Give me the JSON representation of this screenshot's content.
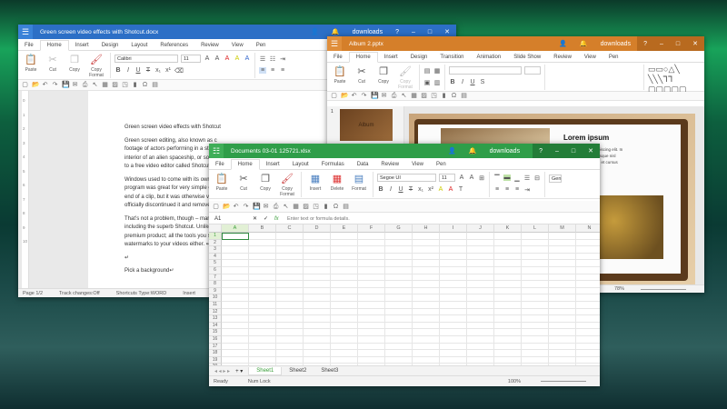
{
  "word": {
    "title": "Green screen video effects with Shotcut.docx",
    "user": "downloads",
    "tabs": [
      "File",
      "Home",
      "Insert",
      "Design",
      "Layout",
      "References",
      "Review",
      "View",
      "Pen"
    ],
    "active_tab": "Home",
    "clipboard": [
      "Paste",
      "Cut",
      "Copy",
      "Copy Format"
    ],
    "font": "Calibri",
    "size": "11",
    "quick_icons": [
      "new-icon",
      "open-icon",
      "undo-icon",
      "redo-icon",
      "save-icon",
      "mail-icon",
      "print-icon",
      "pointer-icon",
      "table-icon",
      "image-icon",
      "shape-icon",
      "chart-icon",
      "omega-icon",
      "note-icon"
    ],
    "paragraphs": [
      "Green screen video effects with Shotcut",
      "Green screen editing, also known as c|footage of actors performing in a stu|interior of an alien spaceship, or som|to a free video editor called Shotcut, ",
      "Windows used to come with its own v|program was great for very simple ed|end of a clip, but it was otherwise ver|officially discontinued it and removed",
      "That’s not a problem, though – many|including the superb Shotcut. Unlike c|premium product; all the tools you se|watermarks to your videos either. ↵",
      "↵",
      "Pick a background↵"
    ],
    "ruler": [
      "0",
      "1",
      "2",
      "3",
      "4",
      "5",
      "6",
      "7",
      "8",
      "9",
      "10"
    ],
    "status": [
      "Page 1/2",
      "Track changes:Off",
      "Shortcuts Type:WORD",
      "Insert"
    ]
  },
  "ppt": {
    "title": "Album 2.pptx",
    "user": "downloads",
    "tabs": [
      "File",
      "Home",
      "Insert",
      "Design",
      "Transition",
      "Animation",
      "Slide Show",
      "Review",
      "View",
      "Pen"
    ],
    "active_tab": "Home",
    "clipboard": [
      "Paste",
      "Cut",
      "Copy",
      "Copy Format"
    ],
    "thumbs": [
      {
        "num": "1",
        "label": "Album"
      },
      {
        "num": "2",
        "label": ""
      }
    ],
    "slide": {
      "heading": "Lorem ipsum",
      "body": [
        "...t, consectetur adipiscing elit. In",
        "...pulvinar, at scelerisque nisl",
        "...t malesuada nulla, et cursus"
      ]
    },
    "zoom": "78%"
  },
  "excel": {
    "title": "Documents 03-01 125721.xlsx",
    "user": "downloads",
    "tabs": [
      "File",
      "Home",
      "Insert",
      "Layout",
      "Formulas",
      "Data",
      "Review",
      "View",
      "Pen"
    ],
    "active_tab": "Home",
    "clipboard": [
      "Paste",
      "Cut",
      "Copy",
      "Copy Format"
    ],
    "cells": [
      "Insert",
      "Delete",
      "Format"
    ],
    "font": "Segoe UI",
    "size": "11",
    "number_format": "Gen",
    "name_box": "A1",
    "formula_placeholder": "Enter text or formula details.",
    "columns": [
      "A",
      "B",
      "C",
      "D",
      "E",
      "F",
      "G",
      "H",
      "I",
      "J",
      "K",
      "L",
      "M",
      "N"
    ],
    "rows": [
      "1",
      "2",
      "3",
      "4",
      "5",
      "6",
      "7",
      "8",
      "9",
      "10",
      "11",
      "12",
      "13",
      "14",
      "15",
      "16",
      "17",
      "18",
      "19",
      "20"
    ],
    "sheets": [
      "Sheet1",
      "Sheet2",
      "Sheet3"
    ],
    "active_sheet": "Sheet1",
    "status": [
      "Ready",
      "Num Lock"
    ],
    "zoom": "100%"
  },
  "colors": {
    "word": "#2c6fc6",
    "ppt": "#d57f2a",
    "excel": "#2f9e49"
  }
}
